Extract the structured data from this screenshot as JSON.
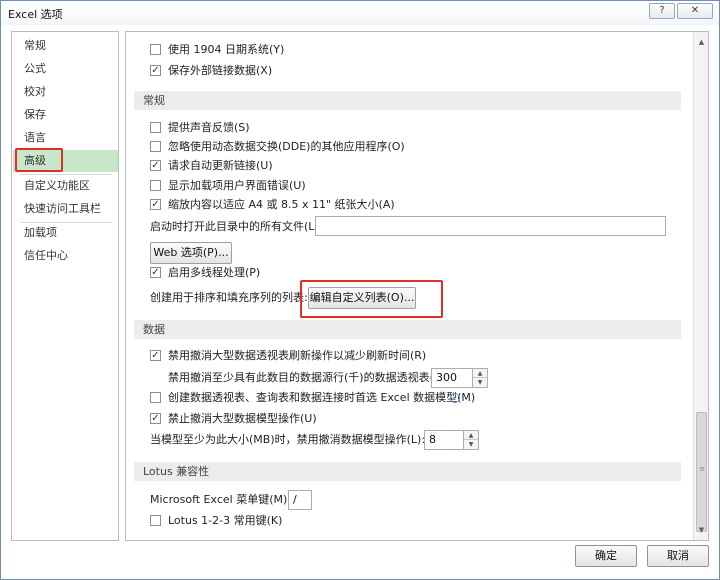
{
  "window": {
    "title": "Excel 选项",
    "help_label": "?",
    "close_label": "✕"
  },
  "sidebar": {
    "items": [
      {
        "label": "常规"
      },
      {
        "label": "公式"
      },
      {
        "label": "校对"
      },
      {
        "label": "保存"
      },
      {
        "label": "语言"
      },
      {
        "label": "高级",
        "selected": true
      },
      {
        "label": "自定义功能区"
      },
      {
        "label": "快速访问工具栏"
      },
      {
        "label": "加载项"
      },
      {
        "label": "信任中心"
      }
    ]
  },
  "content": {
    "top_options": [
      {
        "label": "使用 1904 日期系统(Y)",
        "checked": false
      },
      {
        "label": "保存外部链接数据(X)",
        "checked": true
      }
    ],
    "general": {
      "header": "常规",
      "options": [
        {
          "label": "提供声音反馈(S)",
          "checked": false
        },
        {
          "label": "忽略使用动态数据交换(DDE)的其他应用程序(O)",
          "checked": false
        },
        {
          "label": "请求自动更新链接(U)",
          "checked": true
        },
        {
          "label": "显示加载项用户界面错误(U)",
          "checked": false
        },
        {
          "label": "缩放内容以适应 A4 或 8.5 x 11\" 纸张大小(A)",
          "checked": true
        }
      ],
      "startup_label": "启动时打开此目录中的所有文件(L):",
      "startup_value": "",
      "web_options_button": "Web 选项(P)...",
      "multithread": {
        "label": "启用多线程处理(P)",
        "checked": true
      },
      "custom_list_label": "创建用于排序和填充序列的列表:",
      "custom_list_button": "编辑自定义列表(O)..."
    },
    "data": {
      "header": "数据",
      "disable_undo_refresh": {
        "label": "禁用撤消大型数据透视表刷新操作以减少刷新时间(R)",
        "checked": true
      },
      "undo_rows_label": "禁用撤消至少具有此数目的数据源行(千)的数据透视表(N):",
      "undo_rows_value": "300",
      "prefer_model": {
        "label": "创建数据透视表、查询表和数据连接时首选 Excel 数据模型(M)",
        "checked": false
      },
      "disable_undo_model": {
        "label": "禁止撤消大型数据模型操作(U)",
        "checked": true
      },
      "model_size_label": "当模型至少为此大小(MB)时，禁用撤消数据模型操作(L):",
      "model_size_value": "8"
    },
    "lotus": {
      "header": "Lotus 兼容性",
      "menu_key_label": "Microsoft Excel 菜单键(M):",
      "menu_key_value": "/",
      "lotus_keys": {
        "label": "Lotus 1-2-3 常用键(K)",
        "checked": false
      }
    }
  },
  "footer": {
    "ok_label": "确定",
    "cancel_label": "取消"
  },
  "colors": {
    "selected_bg": "#c8e6c8",
    "highlight_border": "#e0302a",
    "window_border": "#6d8fb6"
  }
}
